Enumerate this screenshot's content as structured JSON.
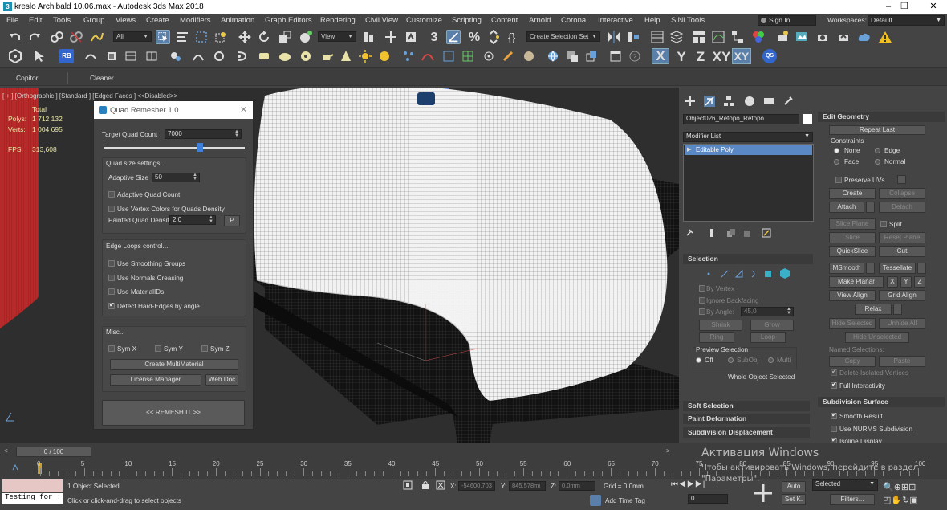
{
  "window": {
    "title": "kreslo Archibald 10.06.max - Autodesk 3ds Max 2018",
    "app_icon": "3"
  },
  "menu": [
    "File",
    "Edit",
    "Tools",
    "Group",
    "Views",
    "Create",
    "Modifiers",
    "Animation",
    "Graph Editors",
    "Rendering",
    "Civil View",
    "Customize",
    "Scripting",
    "Content",
    "Arnold",
    "Corona",
    "Interactive",
    "Help",
    "SiNi Tools"
  ],
  "signin": "Sign In",
  "workspaces": {
    "label": "Workspaces:",
    "value": "Default"
  },
  "toolbar": {
    "filter": "All",
    "refcoord": "View",
    "selset": "Create Selection Set",
    "num3": "3",
    "axes": [
      "X",
      "Y",
      "Z",
      "XY",
      "XY"
    ],
    "qs": "QS",
    "rb": "RB"
  },
  "ribbon": {
    "tabs": [
      "Copitor",
      "Cleaner"
    ]
  },
  "viewport": {
    "label": "[ + ] [Orthographic ] [Standard ] [Edged Faces ]  <<Disabled>>",
    "stats": {
      "total": "Total",
      "polys_label": "Polys:",
      "polys": "1 712 132",
      "verts_label": "Verts:",
      "verts": "1 004 695",
      "fps_label": "FPS:",
      "fps": "313,608"
    }
  },
  "dialog": {
    "title": "Quad Remesher 1.0",
    "target_label": "Target Quad Count",
    "target_value": "7000",
    "slider_pos": 0.68,
    "quad_group": "Quad size settings...",
    "adaptive_label": "Adaptive Size",
    "adaptive_value": "50",
    "adaptive_quad_count": "Adaptive Quad Count",
    "vertex_colors": "Use Vertex Colors for Quads Density",
    "painted_label": "Painted Quad Density",
    "painted_value": "2,0",
    "p_button": "P",
    "edge_group": "Edge Loops control...",
    "smoothing": "Use Smoothing Groups",
    "normals": "Use Normals Creasing",
    "materialids": "Use MaterialIDs",
    "hard_edges": "Detect Hard-Edges by angle",
    "misc_group": "Misc...",
    "symx": "Sym X",
    "symy": "Sym Y",
    "symz": "Sym Z",
    "create_multimaterial": "Create MultiMaterial",
    "license_manager": "License Manager",
    "web_doc": "Web Doc",
    "remesh": "<<    REMESH IT    >>"
  },
  "command_panel": {
    "object_name": "Object026_Retopo_Retopo",
    "modifier_list": "Modifier List",
    "stack_item": "Editable Poly",
    "selection": {
      "title": "Selection",
      "by_vertex": "By Vertex",
      "ignore_backfacing": "Ignore Backfacing",
      "by_angle": "By Angle:",
      "angle_value": "45,0",
      "shrink": "Shrink",
      "grow": "Grow",
      "ring": "Ring",
      "loop": "Loop",
      "preview": "Preview Selection",
      "off": "Off",
      "subobj": "SubObj",
      "multi": "Multi",
      "whole": "Whole Object Selected"
    },
    "soft_selection": "Soft Selection",
    "paint_deformation": "Paint Deformation",
    "subdivision_displacement": "Subdivision Displacement",
    "edit_geometry": {
      "title": "Edit Geometry",
      "repeat_last": "Repeat Last",
      "constraints": "Constraints",
      "none": "None",
      "edge": "Edge",
      "face": "Face",
      "normal": "Normal",
      "preserve_uvs": "Preserve UVs",
      "create": "Create",
      "collapse": "Collapse",
      "attach": "Attach",
      "detach": "Detach",
      "slice_plane": "Slice Plane",
      "split": "Split",
      "slice": "Slice",
      "reset_plane": "Reset Plane",
      "quickslice": "QuickSlice",
      "cut": "Cut",
      "msmooth": "MSmooth",
      "tessellate": "Tessellate",
      "make_planar": "Make Planar",
      "x": "X",
      "y": "Y",
      "z": "Z",
      "view_align": "View Align",
      "grid_align": "Grid Align",
      "relax": "Relax",
      "hide_selected": "Hide Selected",
      "unhide_all": "Unhide All",
      "hide_unselected": "Hide Unselected",
      "named_selections": "Named Selections:",
      "copy": "Copy",
      "paste": "Paste",
      "delete_isolated": "Delete Isolated Vertices",
      "full_interactivity": "Full Interactivity"
    },
    "subdivision_surface": {
      "title": "Subdivision Surface",
      "smooth_result": "Smooth Result",
      "nurms": "Use NURMS Subdivision",
      "isoline": "Isoline Display"
    }
  },
  "timeline": {
    "frame": "0 / 100",
    "ticks": [
      "0",
      "5",
      "10",
      "15",
      "20",
      "25",
      "30",
      "35",
      "40",
      "45",
      "50",
      "55",
      "60",
      "65",
      "70",
      "75",
      "80",
      "85",
      "90",
      "95",
      "100"
    ]
  },
  "status": {
    "listener": "Testing for :",
    "selected": "1 Object Selected",
    "hint": "Click or click-and-drag to select objects",
    "x_label": "X:",
    "x_value": "-54600,703",
    "y_label": "Y:",
    "y_value": "845,578mi",
    "z_label": "Z:",
    "z_value": "0,0mm",
    "grid": "Grid = 0,0mm",
    "add_time_tag": "Add Time Tag",
    "auto": "Auto",
    "set_key": "Set K.",
    "selected_dd": "Selected",
    "filters": "Filters...",
    "frame_field": "0"
  },
  "activation": {
    "title": "Активация Windows",
    "text": "Чтобы активировать Windows, перейдите в раздел \"Параметры\"."
  }
}
